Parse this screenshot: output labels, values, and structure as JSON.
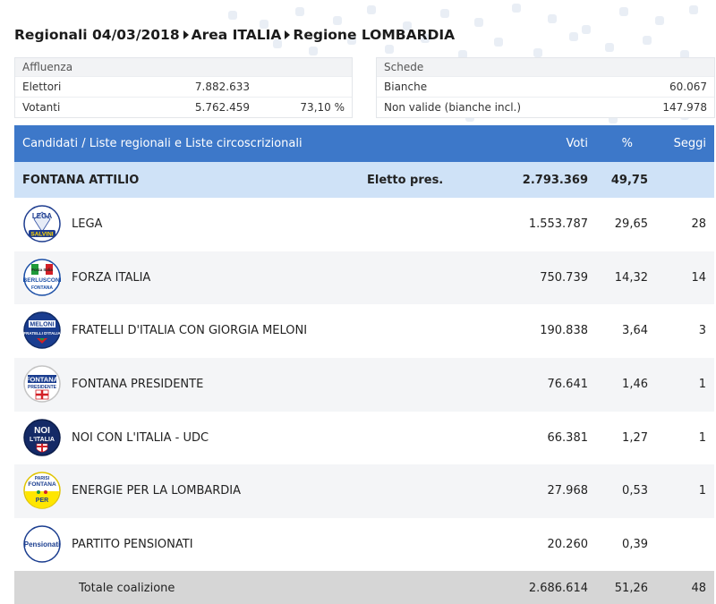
{
  "breadcrumb": {
    "election": "Regionali 04/03/2018",
    "area": "Area ITALIA",
    "region": "Regione LOMBARDIA"
  },
  "affluenza": {
    "title": "Affluenza",
    "rows": [
      {
        "label": "Elettori",
        "value": "7.882.633",
        "extra": ""
      },
      {
        "label": "Votanti",
        "value": "5.762.459",
        "extra": "73,10 %"
      }
    ]
  },
  "schede": {
    "title": "Schede",
    "rows": [
      {
        "label": "Bianche",
        "value": "60.067"
      },
      {
        "label": "Non valide (bianche incl.)",
        "value": "147.978"
      }
    ]
  },
  "table": {
    "headers": {
      "candidati": "Candidati / Liste regionali e Liste circoscrizionali",
      "voti": "Voti",
      "perc": "%",
      "seggi": "Seggi"
    },
    "candidate": {
      "name": "FONTANA ATTILIO",
      "status": "Eletto pres.",
      "voti": "2.793.369",
      "perc": "49,75"
    },
    "parties": [
      {
        "name": "LEGA",
        "voti": "1.553.787",
        "perc": "29,65",
        "seggi": "28",
        "logo": {
          "icon": "lega-logo",
          "top": "LEGA",
          "bottom": "SALVINI"
        }
      },
      {
        "name": "FORZA ITALIA",
        "voti": "750.739",
        "perc": "14,32",
        "seggi": "14",
        "logo": {
          "icon": "forza-italia-logo",
          "top": "Forza Italia",
          "mid": "BERLUSCONI",
          "bottom": "FONTANA"
        }
      },
      {
        "name": "FRATELLI D'ITALIA CON GIORGIA MELONI",
        "voti": "190.838",
        "perc": "3,64",
        "seggi": "3",
        "logo": {
          "icon": "fratelli-italia-logo",
          "top": "MELONI",
          "mid": "FRATELLI D'ITALIA"
        }
      },
      {
        "name": "FONTANA PRESIDENTE",
        "voti": "76.641",
        "perc": "1,46",
        "seggi": "1",
        "logo": {
          "icon": "fontana-presidente-logo",
          "top": "FONTANA",
          "mid": "PRESIDENTE"
        }
      },
      {
        "name": "NOI CON L'ITALIA - UDC",
        "voti": "66.381",
        "perc": "1,27",
        "seggi": "1",
        "logo": {
          "icon": "noi-con-italia-logo",
          "top": "NOI",
          "mid": "L'ITALIA"
        }
      },
      {
        "name": "ENERGIE PER LA LOMBARDIA",
        "voti": "27.968",
        "perc": "0,53",
        "seggi": "1",
        "logo": {
          "icon": "energie-lombardia-logo",
          "top": "PARISI",
          "mid": "FONTANA",
          "bottom": "PER"
        }
      },
      {
        "name": "PARTITO PENSIONATI",
        "voti": "20.260",
        "perc": "0,39",
        "seggi": "",
        "logo": {
          "icon": "partito-pensionati-logo",
          "top": "Pensionati"
        }
      }
    ],
    "total": {
      "label": "Totale coalizione",
      "voti": "2.686.614",
      "perc": "51,26",
      "seggi": "48"
    }
  },
  "colors": {
    "header_bg": "#3d78c9",
    "candidate_bg": "#cfe2f7",
    "total_bg": "#d6d6d6",
    "stripe_bg": "#f4f5f7"
  }
}
